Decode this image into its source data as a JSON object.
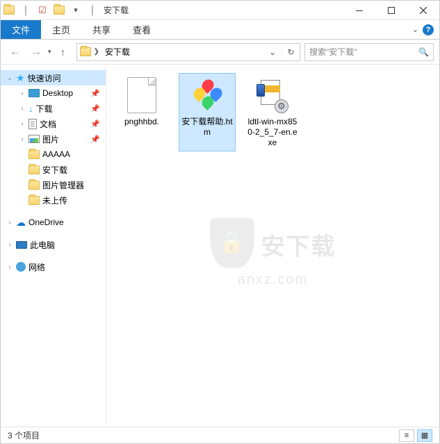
{
  "window": {
    "title": "安下载"
  },
  "ribbon": {
    "file": "文件",
    "home": "主页",
    "share": "共享",
    "view": "查看"
  },
  "breadcrumb": {
    "current": "安下载"
  },
  "search": {
    "placeholder": "搜索\"安下载\""
  },
  "sidebar": {
    "quick": "快速访问",
    "desktop": "Desktop",
    "downloads": "下载",
    "documents": "文档",
    "pictures": "图片",
    "aaaaa": "AAAAA",
    "anxiazai": "安下载",
    "picmgr": "图片管理器",
    "notuploaded": "未上传",
    "onedrive": "OneDrive",
    "thispc": "此电脑",
    "network": "网络"
  },
  "files": {
    "f1": "pnghhbd.",
    "f2": "安下载帮助.htm",
    "f3": "ldtl-win-mx850-2_5_7-en.exe"
  },
  "watermark": {
    "line1": "安下载",
    "line2": "anxz.com"
  },
  "status": {
    "count": "3 个项目"
  }
}
